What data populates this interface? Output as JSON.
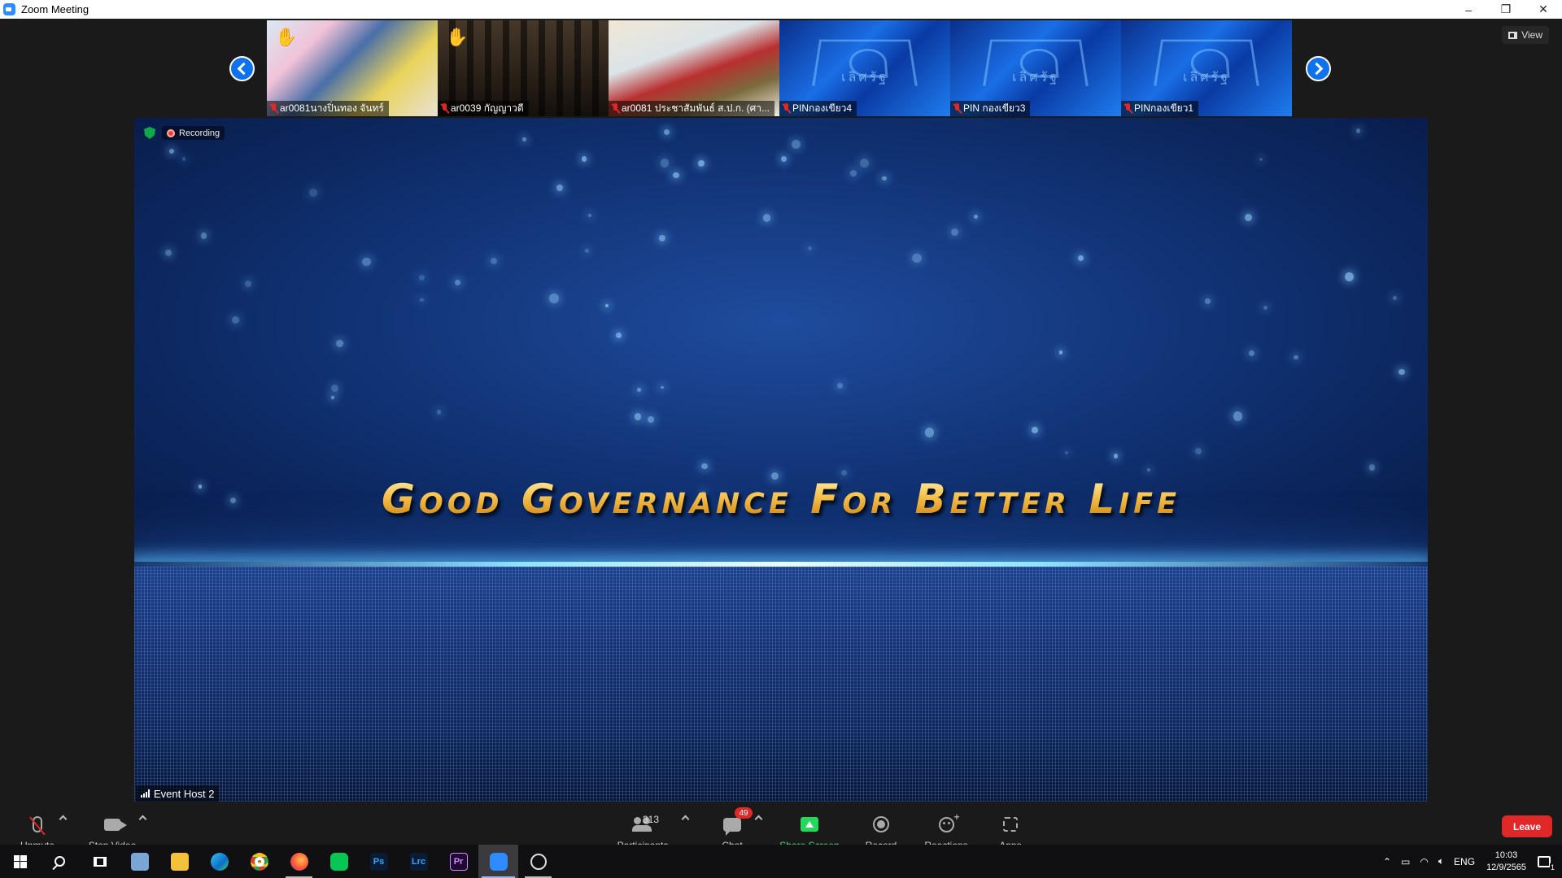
{
  "window": {
    "title": "Zoom Meeting",
    "controls": [
      "–",
      "❐",
      "✕"
    ]
  },
  "view_button": {
    "label": "View"
  },
  "thumbnails": [
    {
      "name": "ar0081นางปิ่นทอง จันทร์",
      "hand_raised": true,
      "muted": true,
      "style": "ph1"
    },
    {
      "name": "ar0039 กัญญาวดี",
      "hand_raised": true,
      "muted": true,
      "style": "ph2"
    },
    {
      "name": "ar0081 ประชาสัมพันธ์ ส.ป.ก. (ศา...",
      "hand_raised": false,
      "muted": true,
      "style": "ph3"
    },
    {
      "name": "PINกองเขียว4",
      "hand_raised": false,
      "muted": true,
      "style": "logo"
    },
    {
      "name": "PIN กองเขียว3",
      "hand_raised": false,
      "muted": true,
      "style": "logo"
    },
    {
      "name": "PINกองเขียว1",
      "hand_raised": false,
      "muted": true,
      "style": "logo"
    }
  ],
  "logo_text": "เลิศรัฐ",
  "stage": {
    "recording_label": "Recording",
    "headline": "Good Governance for Better Life",
    "speaker_name": "Event Host 2"
  },
  "toolbar": {
    "unmute": "Unmute",
    "stop_video": "Stop Video",
    "participants": "Participants",
    "participants_count": "313",
    "chat": "Chat",
    "chat_badge": "49",
    "share_screen": "Share Screen",
    "record": "Record",
    "reactions": "Reactions",
    "apps": "Apps",
    "leave": "Leave"
  },
  "taskbar": {
    "language": "ENG",
    "time": "10:03",
    "date": "12/9/2565",
    "notifications": "1"
  },
  "colors": {
    "accent": "#0e72ed",
    "leave": "#e02828",
    "share": "#23d959"
  }
}
